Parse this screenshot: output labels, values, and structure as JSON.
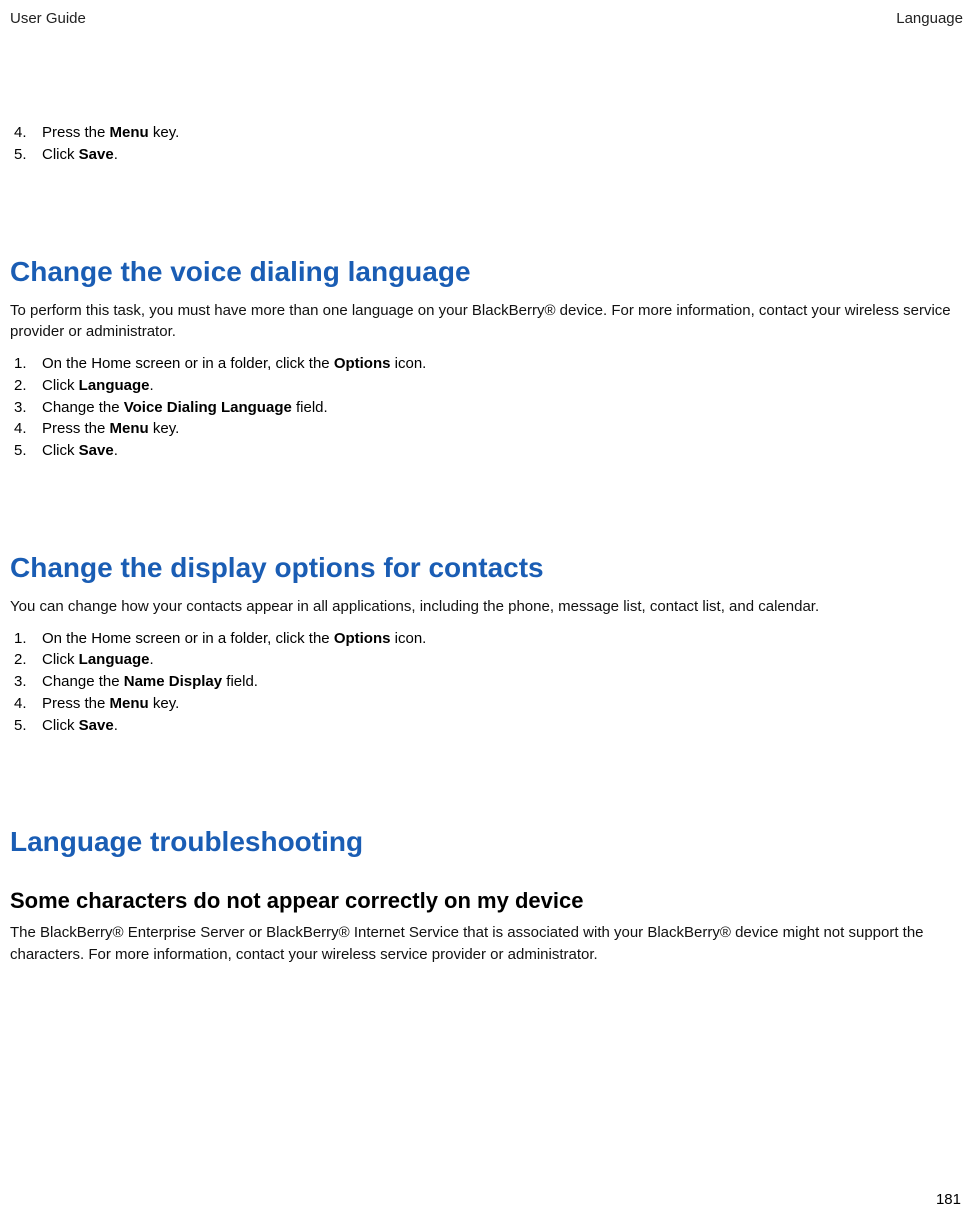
{
  "header": {
    "left": "User Guide",
    "right": "Language"
  },
  "intro_steps": [
    {
      "num": "4.",
      "prefix": "Press the ",
      "bold": "Menu",
      "suffix": " key."
    },
    {
      "num": "5.",
      "prefix": "Click ",
      "bold": "Save",
      "suffix": "."
    }
  ],
  "section1": {
    "heading": "Change the voice dialing language",
    "intro": "To perform this task, you must have more than one language on your BlackBerry® device. For more information, contact your wireless service provider or administrator.",
    "steps": [
      {
        "num": "1.",
        "prefix": "On the Home screen or in a folder, click the ",
        "bold": "Options",
        "suffix": " icon."
      },
      {
        "num": "2.",
        "prefix": "Click ",
        "bold": "Language",
        "suffix": "."
      },
      {
        "num": "3.",
        "prefix": "Change the ",
        "bold": "Voice Dialing Language",
        "suffix": " field."
      },
      {
        "num": "4.",
        "prefix": "Press the ",
        "bold": "Menu",
        "suffix": " key."
      },
      {
        "num": "5.",
        "prefix": "Click ",
        "bold": "Save",
        "suffix": "."
      }
    ]
  },
  "section2": {
    "heading": "Change the display options for contacts",
    "intro": "You can change how your contacts appear in all applications, including the phone, message list, contact list, and calendar.",
    "steps": [
      {
        "num": "1.",
        "prefix": "On the Home screen or in a folder, click the ",
        "bold": "Options",
        "suffix": " icon."
      },
      {
        "num": "2.",
        "prefix": "Click ",
        "bold": "Language",
        "suffix": "."
      },
      {
        "num": "3.",
        "prefix": "Change the ",
        "bold": "Name Display",
        "suffix": " field."
      },
      {
        "num": "4.",
        "prefix": "Press the ",
        "bold": "Menu",
        "suffix": " key."
      },
      {
        "num": "5.",
        "prefix": "Click ",
        "bold": "Save",
        "suffix": "."
      }
    ]
  },
  "section3": {
    "heading": "Language troubleshooting",
    "sub_heading": "Some characters do not appear correctly on my device",
    "para": "The BlackBerry® Enterprise Server or BlackBerry® Internet Service that is associated with your BlackBerry® device might not support the characters. For more information, contact your wireless service provider or administrator."
  },
  "page_number": "181"
}
